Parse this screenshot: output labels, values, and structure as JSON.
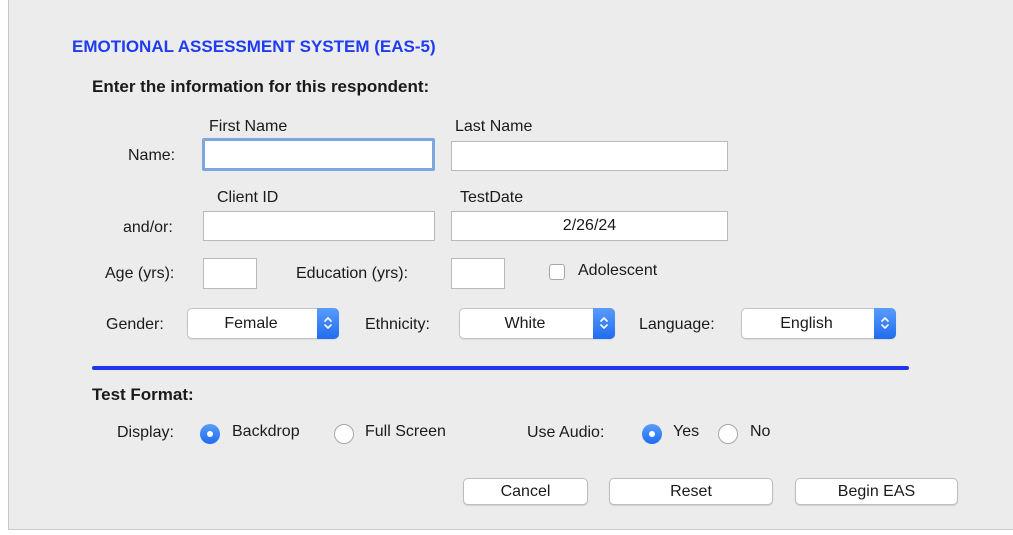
{
  "title": "EMOTIONAL ASSESSMENT SYSTEM (EAS-5)",
  "prompt": "Enter the information for this respondent:",
  "name_row": {
    "label": "Name:",
    "first_name_label": "First Name",
    "last_name_label": "Last Name",
    "first_name_value": "",
    "last_name_value": ""
  },
  "id_row": {
    "label": "and/or:",
    "client_id_label": "Client ID",
    "test_date_label": "TestDate",
    "client_id_value": "",
    "test_date_value": "2/26/24"
  },
  "demographics": {
    "age_label": "Age (yrs):",
    "age_value": "",
    "education_label": "Education (yrs):",
    "education_value": "",
    "adolescent_label": "Adolescent",
    "adolescent_checked": false
  },
  "selects": {
    "gender_label": "Gender:",
    "gender_value": "Female",
    "ethnicity_label": "Ethnicity:",
    "ethnicity_value": "White",
    "language_label": "Language:",
    "language_value": "English"
  },
  "test_format": {
    "heading": "Test Format:",
    "display_label": "Display:",
    "display_options": [
      "Backdrop",
      "Full Screen"
    ],
    "display_selected": "Backdrop",
    "audio_label": "Use Audio:",
    "audio_options": [
      "Yes",
      "No"
    ],
    "audio_selected": "Yes"
  },
  "buttons": {
    "cancel": "Cancel",
    "reset": "Reset",
    "begin": "Begin EAS"
  },
  "colors": {
    "title": "#1e3cf0",
    "divider": "#1b38ef",
    "accent": "#2a76f5",
    "background": "#ececec"
  }
}
